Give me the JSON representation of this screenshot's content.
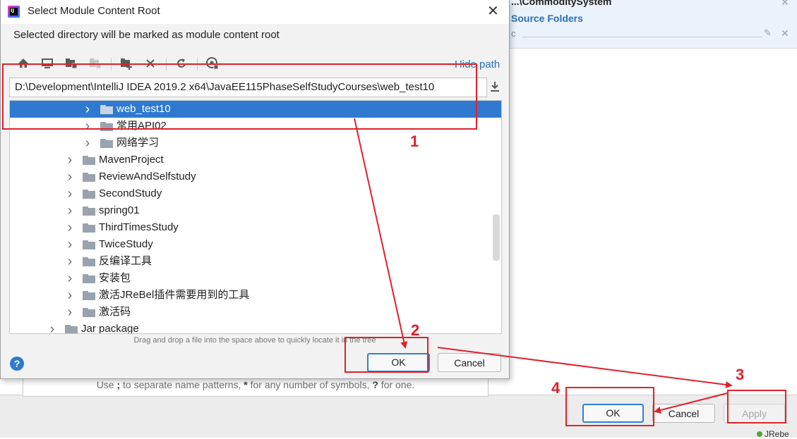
{
  "background": {
    "breadcrumb": "...\\CommoditySystem",
    "section_title": "Source Folders",
    "src_value": "c",
    "pattern_hint_parts": [
      "Use ",
      ";",
      " to separate name patterns, ",
      "*",
      " for any number of symbols, ",
      "?",
      " for one."
    ],
    "buttons": {
      "ok": "OK",
      "cancel": "Cancel",
      "apply": "Apply"
    },
    "status": "JRebe"
  },
  "dialog": {
    "title": "Select Module Content Root",
    "subtitle": "Selected directory will be marked as module content root",
    "hide_path": "Hide path",
    "path": "D:\\Development\\IntelliJ IDEA 2019.2 x64\\JavaEE115PhaseSelfStudyCourses\\web_test10",
    "tree": [
      {
        "label": "web_test10",
        "depth": 2,
        "selected": true
      },
      {
        "label": "常用API02",
        "depth": 2,
        "selected": false
      },
      {
        "label": "网络学习",
        "depth": 2,
        "selected": false
      },
      {
        "label": "MavenProject",
        "depth": 1,
        "selected": false
      },
      {
        "label": "ReviewAndSelfstudy",
        "depth": 1,
        "selected": false
      },
      {
        "label": "SecondStudy",
        "depth": 1,
        "selected": false
      },
      {
        "label": "spring01",
        "depth": 1,
        "selected": false
      },
      {
        "label": "ThirdTimesStudy",
        "depth": 1,
        "selected": false
      },
      {
        "label": "TwiceStudy",
        "depth": 1,
        "selected": false
      },
      {
        "label": "反编译工具",
        "depth": 1,
        "selected": false
      },
      {
        "label": "安装包",
        "depth": 1,
        "selected": false
      },
      {
        "label": "激活JReBel插件需要用到的工具",
        "depth": 1,
        "selected": false
      },
      {
        "label": "激活码",
        "depth": 1,
        "selected": false
      },
      {
        "label": "Jar package",
        "depth": 0,
        "selected": false
      }
    ],
    "drag_hint": "Drag and drop a file into the space above to quickly locate it in the tree",
    "buttons": {
      "ok": "OK",
      "cancel": "Cancel"
    },
    "help": "?"
  },
  "annotations": {
    "step_labels": [
      "1",
      "2",
      "3",
      "4"
    ],
    "color": "#e0212b"
  },
  "colors": {
    "selection": "#2f7ad0",
    "link": "#2a6fb8",
    "folder": "#9aa3ad"
  }
}
